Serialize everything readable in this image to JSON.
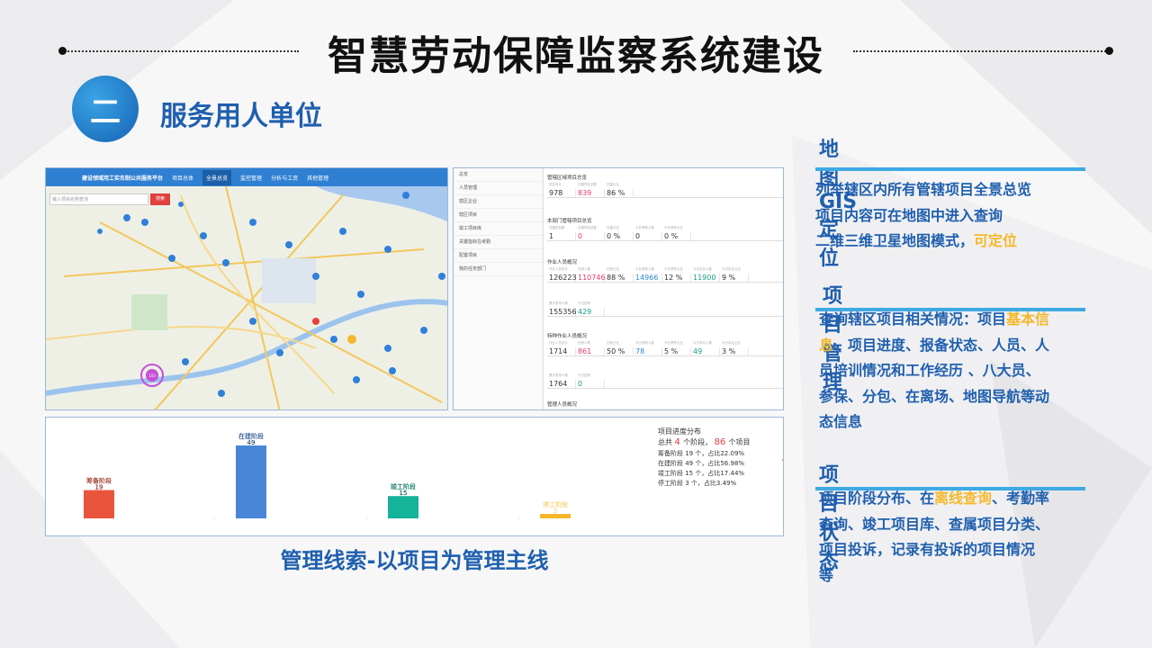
{
  "header": {
    "title": "智慧劳动保障监察系统建设",
    "section_number": "二",
    "section_title": "服务用人单位"
  },
  "map_screenshot": {
    "nav_items": [
      "建设领域用工实名制公共服务平台",
      "项目总体",
      "全景总览",
      "监控管理",
      "分析与工资",
      "其他管理"
    ],
    "search_placeholder": "输入项目名称查询",
    "search_button": "搜索",
    "big_cluster": "103"
  },
  "stats_screenshot": {
    "menu": [
      "总览",
      "人员管理",
      "辖区企业",
      "辖区项目",
      "竣工项目库",
      "关键指标在考勤",
      "配置项目",
      "我的任务部门"
    ],
    "sections": [
      {
        "title": "管辖区域项目总览",
        "labels": [
          "项目总计",
          "在建项目总数",
          "在建占比"
        ],
        "values": [
          "978",
          "839",
          "86 %"
        ],
        "colors": [
          "",
          "red",
          ""
        ]
      },
      {
        "title": "本部门管辖项目总览",
        "labels": [
          "在建项目数",
          "在建项目总数",
          "在建占比",
          "今日考勤人数",
          "今日考勤占比"
        ],
        "values": [
          "1",
          "0",
          "0 %",
          "0",
          "0 %"
        ],
        "colors": [
          "",
          "red",
          "",
          "",
          ""
        ]
      },
      {
        "title": "作业人员概况",
        "labels": [
          "作业人员总计",
          "在册人数",
          "在册占比",
          "今日考勤人数",
          "今日考勤占比",
          "今日实名人数",
          "今日实名占比"
        ],
        "values": [
          "126223",
          "110746",
          "88 %",
          "14966",
          "12 %",
          "11900",
          "9 %"
        ],
        "colors": [
          "",
          "red",
          "",
          "blue",
          "",
          "green",
          ""
        ]
      },
      {
        "title": "",
        "labels": [
          "累计退场人数",
          "今日进场"
        ],
        "values": [
          "155356",
          "429"
        ],
        "colors": [
          "",
          "green"
        ]
      },
      {
        "title": "特种作业人员概况",
        "labels": [
          "作业人员总计",
          "在册人数",
          "在册占比",
          "今日考勤人数",
          "今日考勤占比",
          "今日实名人数",
          "今日实名占比"
        ],
        "values": [
          "1714",
          "861",
          "50 %",
          "78",
          "5 %",
          "49",
          "3 %"
        ],
        "colors": [
          "",
          "red",
          "",
          "blue",
          "",
          "green",
          ""
        ]
      },
      {
        "title": "",
        "labels": [
          "累计退场人数",
          "今日进场"
        ],
        "values": [
          "1764",
          "0"
        ],
        "colors": [
          "",
          "green"
        ]
      },
      {
        "title": "管理人员概况",
        "labels": [],
        "values": [],
        "colors": []
      }
    ]
  },
  "chart_data": {
    "type": "bar",
    "categories": [
      "筹备阶段",
      "在建阶段",
      "竣工阶段",
      "停工阶段"
    ],
    "values": [
      19,
      49,
      15,
      3
    ],
    "colors": [
      "#e8553a",
      "#4a86d8",
      "#15b39a",
      "#f5b82b"
    ],
    "ylim": [
      0,
      52
    ],
    "legend": {
      "title": "项目进度分布",
      "summary_parts": [
        "总共",
        "4",
        "个阶段，",
        "86",
        "个项目"
      ],
      "lines": [
        "筹备阶段 19 个，占比22.09%",
        "在建阶段 49 个，占比56.98%",
        "竣工阶段 15 个，占比17.44%",
        "停工阶段 3 个，占比3.49%"
      ]
    }
  },
  "caption": "管理线索-以项目为管理主线",
  "features": [
    {
      "heading": "地图GIS定位",
      "lines": [
        "列举辖区内所有管辖项目全景总览",
        "项目内容可在地图中进入查询",
        "二维三维卫星地图模式，"
      ],
      "highlight": "可定位"
    },
    {
      "heading": "项目管理",
      "text_a": "查询辖区项目相关情况：项目",
      "hl_a": "基本信",
      "hl_b": "息",
      "text_b": "、项目进度、报备状态、人员、人",
      "lines": [
        "员培训情况和工作经历 、八大员、",
        "参保、分包、在离场、地图导航等动",
        "态信息"
      ]
    },
    {
      "heading": "项目状态",
      "text_a": "项目阶段分布、在",
      "hl": "离线查询",
      "text_b": "、考勤率",
      "lines": [
        "查询、竣工项目库、查属项目分类、",
        "项目投诉，记录有投诉的项目情况",
        "等"
      ]
    }
  ]
}
